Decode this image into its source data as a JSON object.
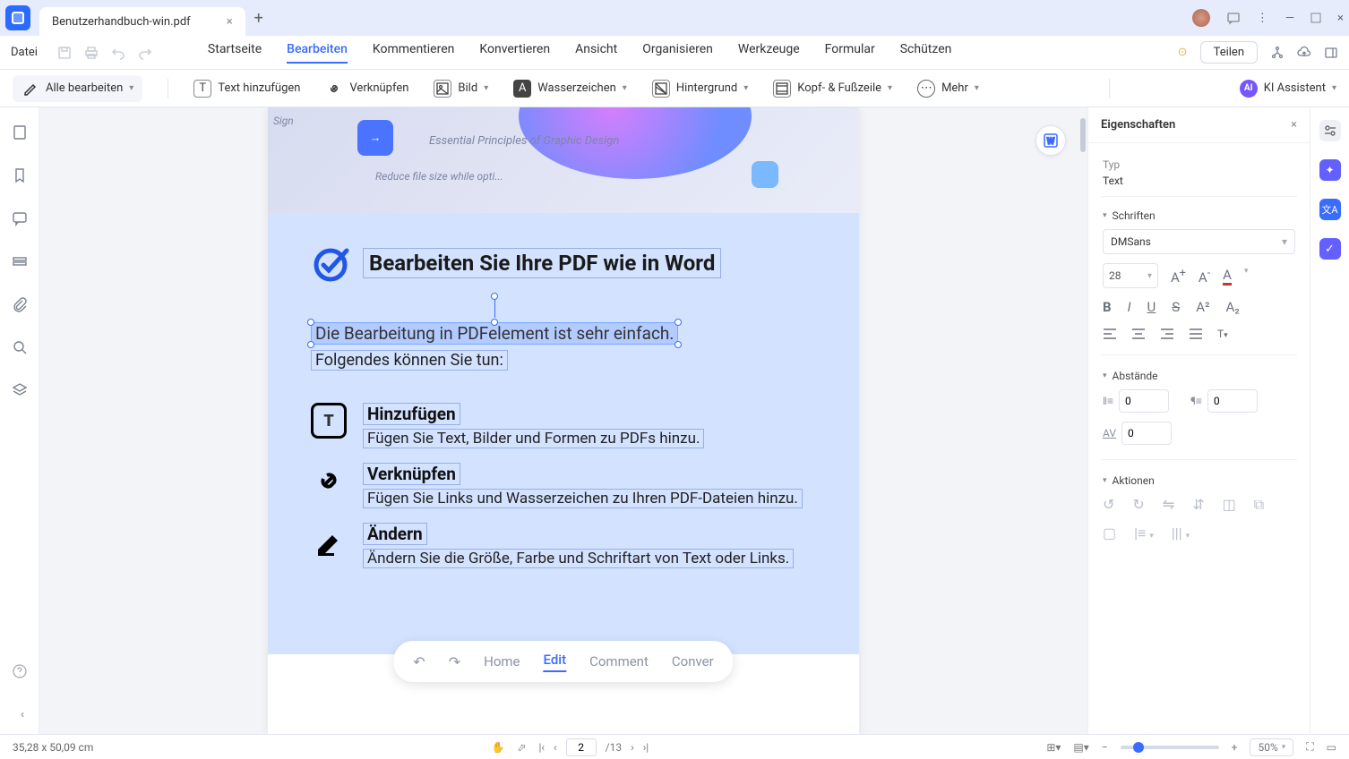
{
  "titlebar": {
    "tab": "Benutzerhandbuch-win.pdf"
  },
  "menu": {
    "file": "Datei",
    "items": [
      "Startseite",
      "Bearbeiten",
      "Kommentieren",
      "Konvertieren",
      "Ansicht",
      "Organisieren",
      "Werkzeuge",
      "Formular",
      "Schützen"
    ],
    "active_index": 1,
    "share": "Teilen"
  },
  "toolbar": {
    "edit_all": "Alle bearbeiten",
    "add_text": "Text hinzufügen",
    "link": "Verknüpfen",
    "image": "Bild",
    "watermark": "Wasserzeichen",
    "background": "Hintergrund",
    "headerfooter": "Kopf- & Fußzeile",
    "more": "Mehr",
    "ai": "KI Assistent"
  },
  "page": {
    "hero": {
      "sign": "Sign",
      "principles": "Essential Principles of Graphic Design",
      "reduce": "Reduce file size while opti..."
    },
    "heading": "Bearbeiten Sie Ihre PDF wie in Word",
    "selected": "Die Bearbeitung in PDFelement ist sehr einfach.",
    "subline": "Folgendes können Sie tun:",
    "feat1": {
      "title": "Hinzufügen",
      "desc": "Fügen Sie Text, Bilder und Formen zu PDFs hinzu."
    },
    "feat2": {
      "title": "Verknüpfen",
      "desc": "Fügen Sie Links und Wasserzeichen zu Ihren PDF-Dateien hinzu."
    },
    "feat3": {
      "title": "Ändern",
      "desc": "Ändern Sie die Größe, Farbe und Schriftart von Text oder Links."
    },
    "pill": {
      "home": "Home",
      "edit": "Edit",
      "comment": "Comment",
      "convert": "Conver"
    }
  },
  "props": {
    "title": "Eigenschaften",
    "type_label": "Typ",
    "type_value": "Text",
    "fonts": "Schriften",
    "font": "DMSans",
    "size": "28",
    "spacing": "Abstände",
    "sp_line": "0",
    "sp_para": "0",
    "sp_char": "0",
    "actions": "Aktionen"
  },
  "status": {
    "dims": "35,28 x 50,09 cm",
    "page": "2",
    "total": "/13",
    "zoom": "50%"
  }
}
